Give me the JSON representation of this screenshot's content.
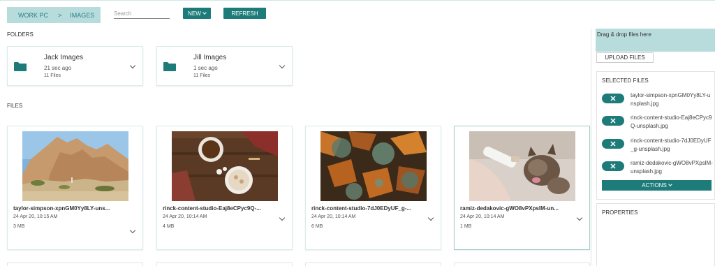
{
  "toolbar": {
    "breadcrumb": [
      "WORK PC",
      ">",
      "IMAGES"
    ],
    "search_placeholder": "Search",
    "new_label": "NEW",
    "refresh_label": "REFRESH"
  },
  "sections": {
    "folders": "FOLDERS",
    "files": "FILES"
  },
  "folders": [
    {
      "name": "Jack Images",
      "modified": "21 sec ago",
      "count": "11 Files"
    },
    {
      "name": "Jill Images",
      "modified": "1 sec ago",
      "count": "11 Files"
    }
  ],
  "files": [
    {
      "name": "taylor-simpson-xpnGM0Yy8LY-uns...",
      "date": "24 Apr 20, 10:15 AM",
      "size": "3 MB"
    },
    {
      "name": "rinck-content-studio-Eaj8eCPyc9Q-...",
      "date": "24 Apr 20, 10:14 AM",
      "size": "4 MB"
    },
    {
      "name": "rinck-content-studio-7dJ0EDyUF_g-...",
      "date": "24 Apr 20, 10:14 AM",
      "size": "6 MB"
    },
    {
      "name": "ramiz-dedakovic-gWO8vPXpslM-un...",
      "date": "24 Apr 20, 10:14 AM",
      "size": "1 MB"
    }
  ],
  "right_panel": {
    "dropzone_text": "Drag & drop files here",
    "upload_label": "UPLOAD FILES",
    "selected_title": "SELECTED FILES",
    "selected_files": [
      "taylor-simpson-xpnGM0Yy8LY-unsplash.jpg",
      "rinck-content-studio-Eaj8eCPyc9Q-unsplash.jpg",
      "rinck-content-studio-7dJ0EDyUF_g-unsplash.jpg",
      "ramiz-dedakovic-gWO8vPXpslM-unsplash.jpg"
    ],
    "remove_glyph": "✕",
    "actions_label": "ACTIONS",
    "properties_title": "PROPERTIES"
  },
  "colors": {
    "accent": "#1d7c79",
    "accent_light": "#b7dcdb",
    "breadcrumb_text": "#2a7f86"
  }
}
